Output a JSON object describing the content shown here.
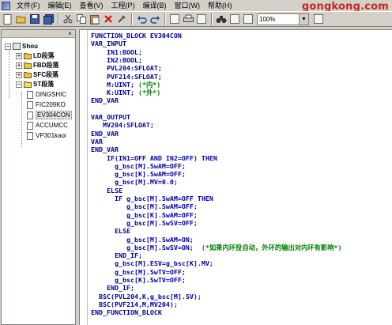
{
  "menu": {
    "items": [
      "文件(F)",
      "编辑(E)",
      "查看(V)",
      "工程(P)",
      "编译(B)",
      "窗口(W)",
      "帮助(H)"
    ]
  },
  "watermark": "gongkong.com",
  "toolbar": {
    "buttons": [
      "new-file",
      "open-folder",
      "save",
      "save-all",
      "cut",
      "copy",
      "paste",
      "delete",
      "build",
      "undo",
      "redo",
      "find-replace",
      "print",
      "print-preview",
      "binoculars-find",
      "find-next",
      "find-prev"
    ],
    "zoom_value": "100%"
  },
  "tree": {
    "root": "Shou",
    "groups": [
      "LD段落",
      "FBD段落",
      "SFC段落",
      "ST段落"
    ],
    "files": [
      "DINGSHIC",
      "FIC209KO",
      "EV304CON",
      "ACCUMCC",
      "VP301kaoi"
    ],
    "selected_file": "EV304CON"
  },
  "code": {
    "lines": [
      {
        "t": "FUNCTION_BLOCK EV304CON",
        "kw": true
      },
      {
        "t": "VAR_INPUT",
        "kw": true
      },
      {
        "t": "    IN1:BOOL;",
        "kw": true
      },
      {
        "t": "    IN2:BOOL;",
        "kw": true
      },
      {
        "t": "    PVL204:SFLOAT;",
        "kw": true
      },
      {
        "t": "    PVF214:SFLOAT;",
        "kw": true
      },
      {
        "t": "    M:UINT;",
        "kw": true,
        "c": "(*内*)"
      },
      {
        "t": "    K:UINT;",
        "kw": true,
        "c": "(*外*)"
      },
      {
        "t": "END_VAR",
        "kw": true
      },
      {
        "t": "",
        "kw": false
      },
      {
        "t": "VAR_OUTPUT",
        "kw": true
      },
      {
        "t": "   MV204:SFLOAT;",
        "kw": true
      },
      {
        "t": "END_VAR",
        "kw": true
      },
      {
        "t": "VAR",
        "kw": true
      },
      {
        "t": "END_VAR",
        "kw": true
      },
      {
        "t": "    IF(IN1=OFF AND IN2=OFF) THEN",
        "kw": true
      },
      {
        "t": "      g_bsc[M].SwAM=OFF;",
        "kw": true
      },
      {
        "t": "      g_bsc[K].SwAM=OFF;",
        "kw": true
      },
      {
        "t": "      g_bsc[M].MV=0.0;",
        "kw": true
      },
      {
        "t": "    ELSE",
        "kw": true
      },
      {
        "t": "      IF g_bsc[M].SwAM=OFF THEN",
        "kw": true
      },
      {
        "t": "         g_bsc[M].SwAM=OFF;",
        "kw": true
      },
      {
        "t": "         g_bsc[K].SwAM=OFF;",
        "kw": true
      },
      {
        "t": "         g_bsc[M].SwSV=OFF;",
        "kw": true
      },
      {
        "t": "      ELSE",
        "kw": true
      },
      {
        "t": "         g_bsc[M].SwAM=ON;",
        "kw": true
      },
      {
        "t": "         g_bsc[M].SwSV=ON;",
        "kw": true,
        "c": "(*如果内环投自动，外环的输出对内环有影响*)"
      },
      {
        "t": "      END_IF;",
        "kw": true
      },
      {
        "t": "      g_bsc[M].ESV=g_bsc[K].MV;",
        "kw": true
      },
      {
        "t": "      g_bsc[M].SwTV=OFF;",
        "kw": true
      },
      {
        "t": "      g_bsc[K].SwTV=OFF;",
        "kw": true
      },
      {
        "t": "    END_IF;",
        "kw": true
      },
      {
        "t": "  BSC(PVL204,K,g_bsc[M].SV);",
        "kw": true
      },
      {
        "t": "  BSC(PVF214,M,MV204);",
        "kw": true
      },
      {
        "t": "END_FUNCTION_BLOCK",
        "kw": true
      }
    ]
  }
}
